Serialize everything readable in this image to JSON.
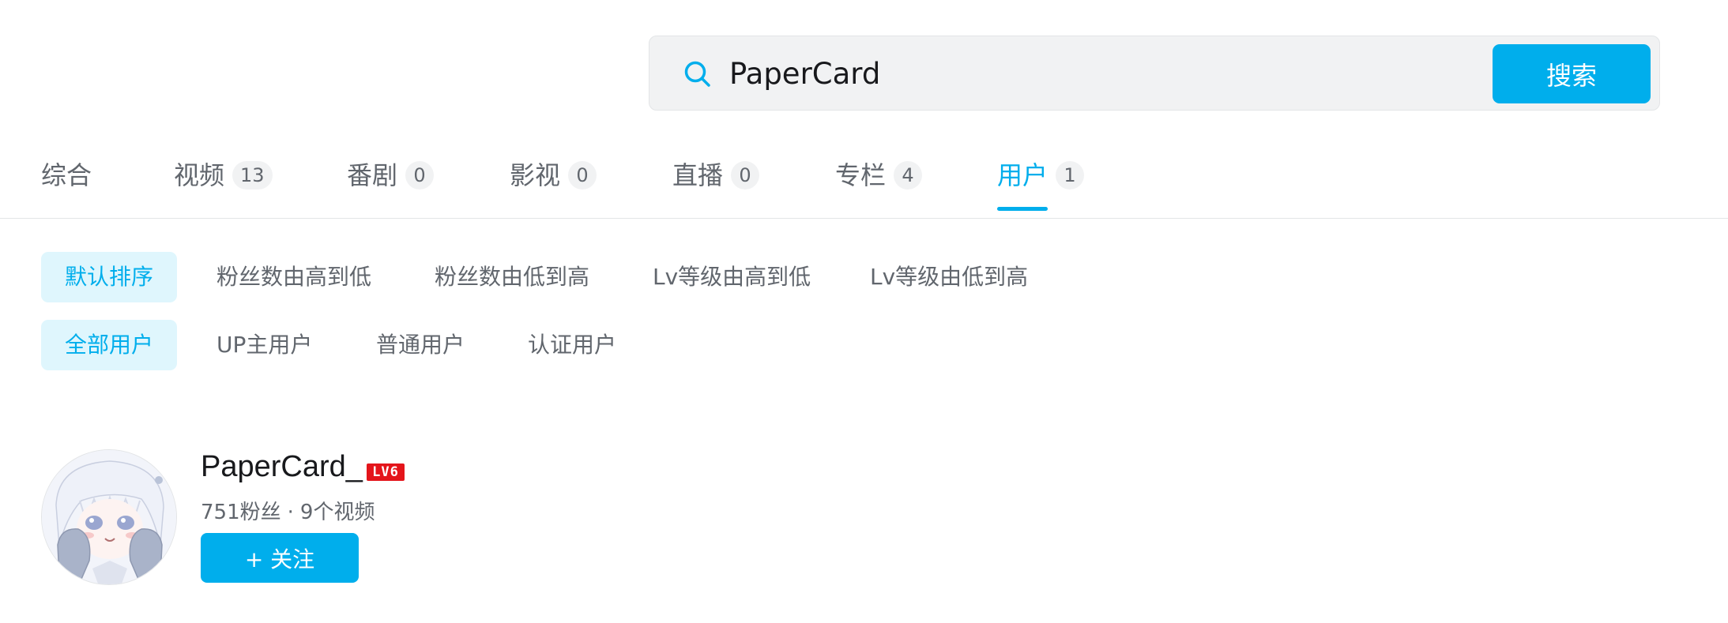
{
  "search": {
    "query": "PaperCard",
    "button_label": "搜索"
  },
  "tabs": [
    {
      "label": "综合",
      "count": ""
    },
    {
      "label": "视频",
      "count": "13"
    },
    {
      "label": "番剧",
      "count": "0"
    },
    {
      "label": "影视",
      "count": "0"
    },
    {
      "label": "直播",
      "count": "0"
    },
    {
      "label": "专栏",
      "count": "4"
    },
    {
      "label": "用户",
      "count": "1",
      "active": true
    }
  ],
  "sort_options": [
    "默认排序",
    "粉丝数由高到低",
    "粉丝数由低到高",
    "Lv等级由高到低",
    "Lv等级由低到高"
  ],
  "user_types": [
    "全部用户",
    "UP主用户",
    "普通用户",
    "认证用户"
  ],
  "user": {
    "name": "PaperCard_",
    "level": "LV6",
    "fans": "751粉丝",
    "separator": "·",
    "videos": "9个视频",
    "follow_label": "+ 关注"
  },
  "colors": {
    "accent": "#00aeec",
    "chip_bg": "#dff6fd",
    "level_badge": "#e4151b"
  }
}
